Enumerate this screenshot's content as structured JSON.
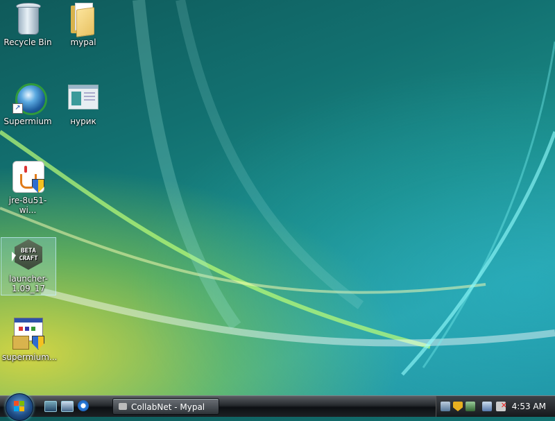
{
  "desktop": {
    "icons": [
      {
        "id": "recycle-bin",
        "label": "Recycle Bin"
      },
      {
        "id": "mypal",
        "label": "mypal"
      },
      {
        "id": "supermium",
        "label": "Supermium"
      },
      {
        "id": "nurik",
        "label": "нурик"
      },
      {
        "id": "jre",
        "label": "jre-8u51-wi..."
      },
      {
        "id": "launcher",
        "label": "launcher-1.09_17"
      },
      {
        "id": "supermium-installer",
        "label": "supermium..."
      }
    ],
    "launcher_logo_text": "BETA CRAFT"
  },
  "taskbar": {
    "window_button_label": "CollabNet - Mypal",
    "clock": "4:53 AM"
  },
  "colors": {
    "taskbar": "#1c2024",
    "wallpaper_teal": "#127070",
    "wallpaper_yellow": "#e6dc3c"
  }
}
